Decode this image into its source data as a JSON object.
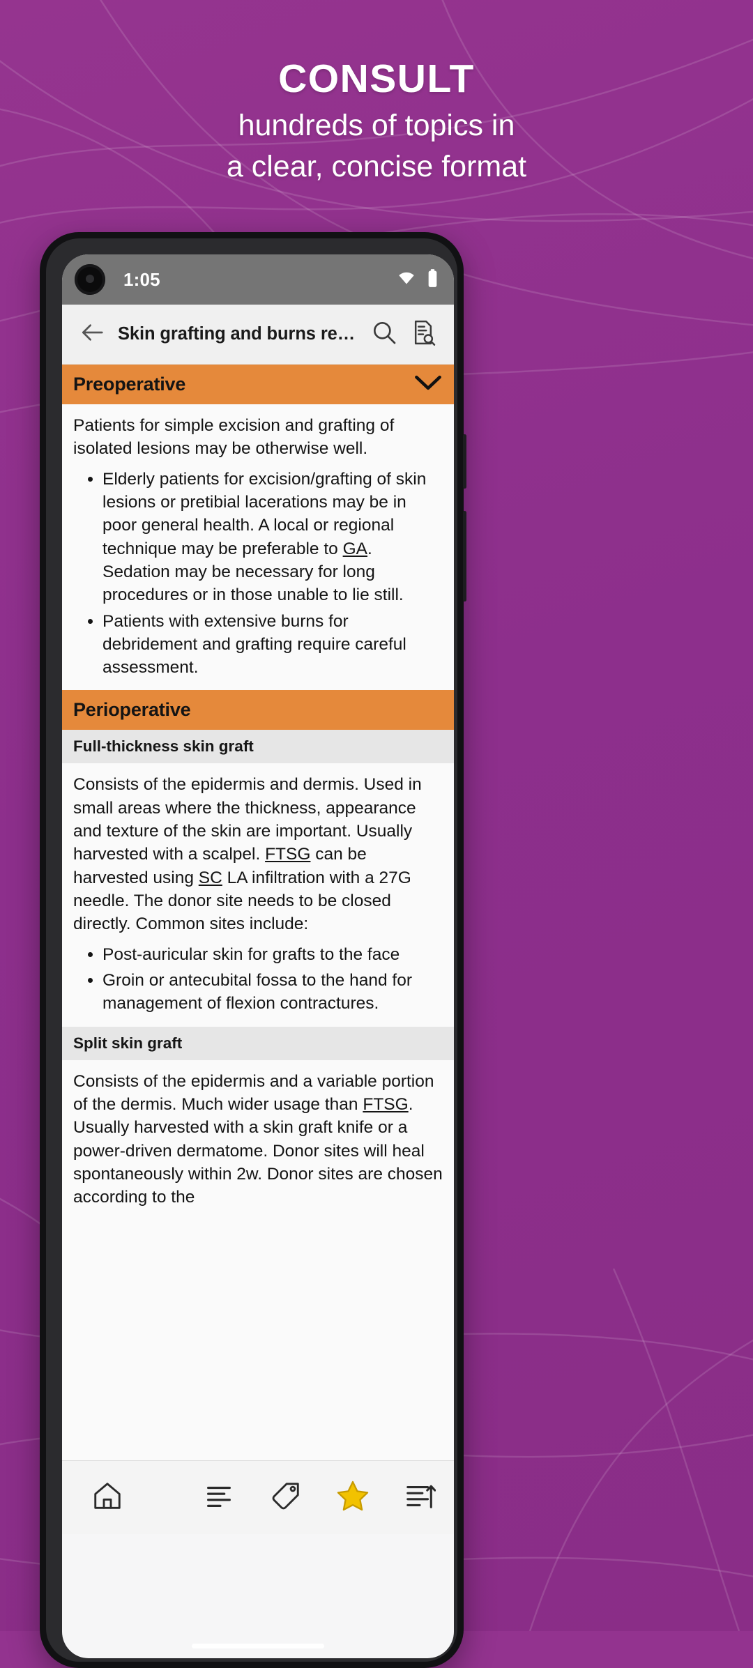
{
  "promo": {
    "title": "CONSULT",
    "subtitle_line1": "hundreds of topics in",
    "subtitle_line2": "a clear, concise format",
    "background_color": "#93338f",
    "text_color": "#ffffff"
  },
  "phone": {
    "status_bar": {
      "time": "1:05",
      "wifi_icon": "wifi-icon",
      "battery_icon": "battery-full-icon",
      "background_color": "#757575"
    },
    "toolbar": {
      "back_icon": "arrow-left-icon",
      "title": "Skin grafting and burns reco…",
      "search_icon": "search-icon",
      "notes_icon": "document-search-icon",
      "background_color": "#f0f0f0"
    },
    "article": {
      "accent_color": "#e5893b",
      "subsection_color": "#e6e6e6",
      "sections": [
        {
          "id": "preoperative",
          "label": "Preoperative",
          "expanded": true,
          "chevron_icon": "chevron-down-icon",
          "intro": "Patients for simple excision and grafting of isolated lesions may be otherwise well.",
          "bullets": [
            "Elderly patients for excision/grafting of skin lesions or pretibial lacerations may be in poor general health. A local or regional technique may be preferable to GA. Sedation may be necessary for long procedures or in those unable to lie still.",
            "Patients with extensive burns for debridement and grafting require careful assessment."
          ]
        },
        {
          "id": "perioperative",
          "label": "Perioperative",
          "expanded": true,
          "subsections": [
            {
              "label": "Full-thickness skin graft",
              "paragraph": "Consists of the epidermis and dermis. Used in small areas where the thickness, appearance and texture of the skin are important. Usually harvested with a scalpel. FTSG can be harvested using SC LA infiltration with a 27G needle. The donor site needs to be closed directly. Common sites include:",
              "bullets": [
                "Post-auricular skin for grafts to the face",
                "Groin or antecubital fossa to the hand for management of flexion contractures."
              ]
            },
            {
              "label": "Split skin graft",
              "paragraph": "Consists of the epidermis and a variable portion of the dermis. Much wider usage than FTSG. Usually harvested with a skin graft knife or a power-driven dermatome. Donor sites will heal spontaneously within 2w. Donor sites are chosen according to the"
            }
          ]
        }
      ]
    },
    "bottom_nav": {
      "background_color": "#f4f4f4",
      "items": [
        {
          "id": "home",
          "icon": "home-icon",
          "active": false
        },
        {
          "id": "contents",
          "icon": "list-lines-icon",
          "active": false
        },
        {
          "id": "tags",
          "icon": "tag-icon",
          "active": false
        },
        {
          "id": "favourites",
          "icon": "star-icon",
          "active": true,
          "color": "#f2c200"
        },
        {
          "id": "outline",
          "icon": "outline-arrow-icon",
          "active": false
        }
      ]
    }
  }
}
